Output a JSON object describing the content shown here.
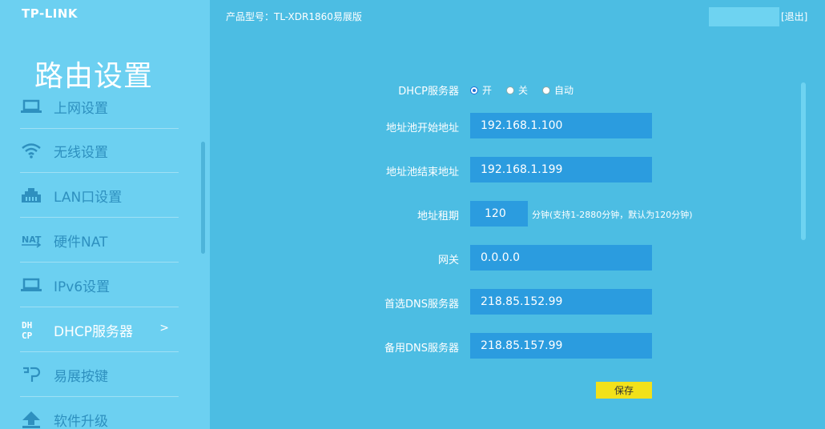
{
  "brand": {
    "logo": "TP-LINK"
  },
  "header": {
    "product_model": "产品型号：TL-XDR1860易展版",
    "logout": "[退出]"
  },
  "sidebar": {
    "title": "路由设置",
    "items": [
      {
        "label": "上网设置",
        "icon": "laptop-icon"
      },
      {
        "label": "无线设置",
        "icon": "wifi-icon"
      },
      {
        "label": "LAN口设置",
        "icon": "lan-port-icon"
      },
      {
        "label": "硬件NAT",
        "icon": "nat-icon"
      },
      {
        "label": "IPv6设置",
        "icon": "laptop-icon"
      },
      {
        "label": "DHCP服务器",
        "icon": "dhcp-icon",
        "active": true,
        "chevron": ">"
      },
      {
        "label": "易展按键",
        "icon": "easy-expand-icon"
      },
      {
        "label": "软件升级",
        "icon": "upgrade-arrow-icon"
      }
    ]
  },
  "form": {
    "dhcp": {
      "label": "DHCP服务器",
      "options": [
        "开",
        "关",
        "自动"
      ],
      "selected": "开"
    },
    "pool_start": {
      "label": "地址池开始地址",
      "value": "192.168.1.100"
    },
    "pool_end": {
      "label": "地址池结束地址",
      "value": "192.168.1.199"
    },
    "lease": {
      "label": "地址租期",
      "value": "120",
      "hint": "分钟(支持1-2880分钟，默认为120分钟)"
    },
    "gateway": {
      "label": "网关",
      "value": "0.0.0.0"
    },
    "dns_primary": {
      "label": "首选DNS服务器",
      "value": "218.85.152.99"
    },
    "dns_secondary": {
      "label": "备用DNS服务器",
      "value": "218.85.157.99"
    },
    "save_label": "保存"
  },
  "colors": {
    "sidebar_bg": "#6cd0f1",
    "main_bg": "#4cbde3",
    "input_bg": "#2b9cdf",
    "save_bg": "#f2e11a",
    "nav_text": "#2e90bf"
  }
}
